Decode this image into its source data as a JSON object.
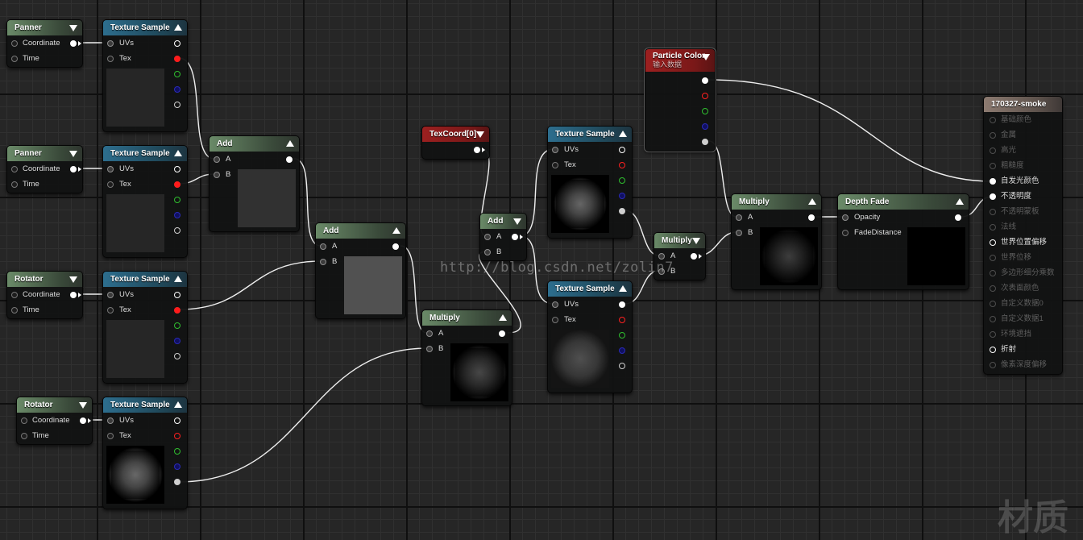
{
  "panner1": {
    "title": "Panner",
    "in0": "Coordinate",
    "in1": "Time"
  },
  "panner2": {
    "title": "Panner",
    "in0": "Coordinate",
    "in1": "Time"
  },
  "rotator1": {
    "title": "Rotator",
    "in0": "Coordinate",
    "in1": "Time"
  },
  "rotator2": {
    "title": "Rotator",
    "in0": "Coordinate",
    "in1": "Time"
  },
  "tex1": {
    "title": "Texture Sample",
    "in0": "UVs",
    "in1": "Tex"
  },
  "tex2": {
    "title": "Texture Sample",
    "in0": "UVs",
    "in1": "Tex"
  },
  "tex3": {
    "title": "Texture Sample",
    "in0": "UVs",
    "in1": "Tex"
  },
  "tex4": {
    "title": "Texture Sample",
    "in0": "UVs",
    "in1": "Tex"
  },
  "tex5": {
    "title": "Texture Sample",
    "in0": "UVs",
    "in1": "Tex"
  },
  "tex6": {
    "title": "Texture Sample",
    "in0": "UVs",
    "in1": "Tex"
  },
  "add1": {
    "title": "Add",
    "in0": "A",
    "in1": "B"
  },
  "add2": {
    "title": "Add",
    "in0": "A",
    "in1": "B"
  },
  "add3": {
    "title": "Add",
    "in0": "A",
    "in1": "B"
  },
  "mul1": {
    "title": "Multiply",
    "in0": "A",
    "in1": "B"
  },
  "mul2": {
    "title": "Multiply",
    "in0": "A",
    "in1": "B"
  },
  "mul3": {
    "title": "Multiply",
    "in0": "A",
    "in1": "B"
  },
  "texcoord": {
    "title": "TexCoord[0]"
  },
  "particle": {
    "title": "Particle Color",
    "subtitle": "输入数据"
  },
  "depthfade": {
    "title": "Depth Fade",
    "in0": "Opacity",
    "in1": "FadeDistance"
  },
  "root": {
    "title": "170327-smoke",
    "pins": [
      "基础颜色",
      "金属",
      "高光",
      "粗糙度",
      "自发光颜色",
      "不透明度",
      "不透明蒙板",
      "法线",
      "世界位置偏移",
      "世界位移",
      "多边形细分乘数",
      "次表面颜色",
      "自定义数据0",
      "自定义数据1",
      "环境遮挡",
      "折射",
      "像素深度偏移"
    ]
  },
  "watermark": "http://blog.csdn.net/zolin7",
  "corner_mark": "材质"
}
